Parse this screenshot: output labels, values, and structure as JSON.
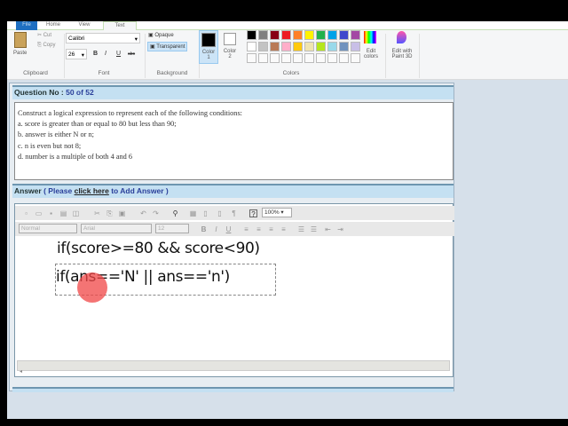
{
  "ribbon": {
    "tabs": [
      "File",
      "Home",
      "View",
      "Text"
    ],
    "clipboard": {
      "paste": "Paste",
      "cut": "Cut",
      "copy": "Copy",
      "label": "Clipboard"
    },
    "font": {
      "name": "Calibri",
      "size": "26",
      "bold": "B",
      "italic": "I",
      "underline": "U",
      "strike": "abc",
      "label": "Font"
    },
    "background": {
      "opaque": "Opaque",
      "transparent": "Transparent",
      "label": "Background"
    },
    "colors": {
      "color1": "Color 1",
      "color2": "Color 2",
      "label": "Colors",
      "edit": "Edit colors",
      "paint3d": "Edit with Paint 3D",
      "palette_row1": [
        "#000000",
        "#7f7f7f",
        "#880015",
        "#ed1c24",
        "#ff7f27",
        "#fff200",
        "#22b14c",
        "#00a2e8",
        "#3f48cc",
        "#a349a4"
      ],
      "palette_row2": [
        "#ffffff",
        "#c3c3c3",
        "#b97a57",
        "#ffaec9",
        "#ffc90e",
        "#efe4b0",
        "#b5e61d",
        "#99d9ea",
        "#7092be",
        "#c8bfe7"
      ]
    }
  },
  "question": {
    "label": "Question No : ",
    "number": "50 of 52",
    "lines": [
      "Construct a logical expression to represent each of the following conditions:",
      "a. score is greater than or equal to 80 but less than 90;",
      "b. answer is either N or n;",
      "c. n is even but not 8;",
      "d. number is a multiple of both 4 and 6"
    ]
  },
  "answer": {
    "label": "Answer",
    "pre": "( Please ",
    "link": "click here",
    "post": " to Add Answer )"
  },
  "editor": {
    "zoom": "100%",
    "style": "Normal",
    "font": "Arial",
    "size": "12",
    "lines": [
      "if(score>=80 && score<90)",
      "if(ans=='N' || ans=='n')"
    ]
  }
}
